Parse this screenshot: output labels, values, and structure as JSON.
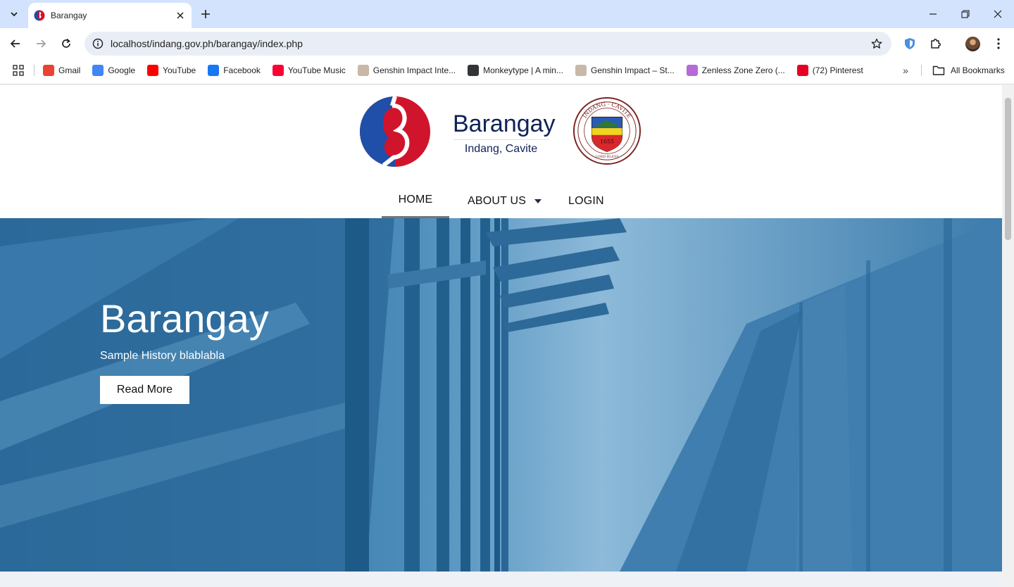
{
  "browser": {
    "tab": {
      "title": "Barangay"
    },
    "address": {
      "url": "localhost/indang.gov.ph/barangay/index.php"
    },
    "bookmarks": [
      {
        "label": "Gmail",
        "icon": "gmail-icon",
        "color": "#ea4335"
      },
      {
        "label": "Google",
        "icon": "google-icon",
        "color": "#4285f4"
      },
      {
        "label": "YouTube",
        "icon": "youtube-icon",
        "color": "#ff0000"
      },
      {
        "label": "Facebook",
        "icon": "facebook-icon",
        "color": "#1877f2"
      },
      {
        "label": "YouTube Music",
        "icon": "youtube-music-icon",
        "color": "#ff0033"
      },
      {
        "label": "Genshin Impact Inte...",
        "icon": "genshin-icon",
        "color": "#c9b8a8"
      },
      {
        "label": "Monkeytype | A min...",
        "icon": "monkeytype-icon",
        "color": "#323437"
      },
      {
        "label": "Genshin Impact – St...",
        "icon": "genshin-icon",
        "color": "#c9b8a8"
      },
      {
        "label": "Zenless Zone Zero (...",
        "icon": "zenless-icon",
        "color": "#b46bd6"
      },
      {
        "label": "(72) Pinterest",
        "icon": "pinterest-icon",
        "color": "#e60023"
      }
    ],
    "all_bookmarks": "All Bookmarks"
  },
  "site": {
    "brand_title": "Barangay",
    "brand_subtitle": "Indang, Cavite",
    "seal": {
      "top_text": "INDANG · CAVITE",
      "year": "1655",
      "motto": "LORD BLESS"
    },
    "nav": [
      {
        "label": "HOME",
        "active": true
      },
      {
        "label": "ABOUT US",
        "dropdown": true
      },
      {
        "label": "LOGIN"
      }
    ],
    "hero": {
      "title": "Barangay",
      "subtitle": "Sample History blablabla",
      "button": "Read More"
    }
  },
  "colors": {
    "brand_navy": "#0f2258",
    "logo_blue": "#1f4fa8",
    "logo_red": "#d0142c",
    "hero_blue": "#2f6f9f"
  }
}
